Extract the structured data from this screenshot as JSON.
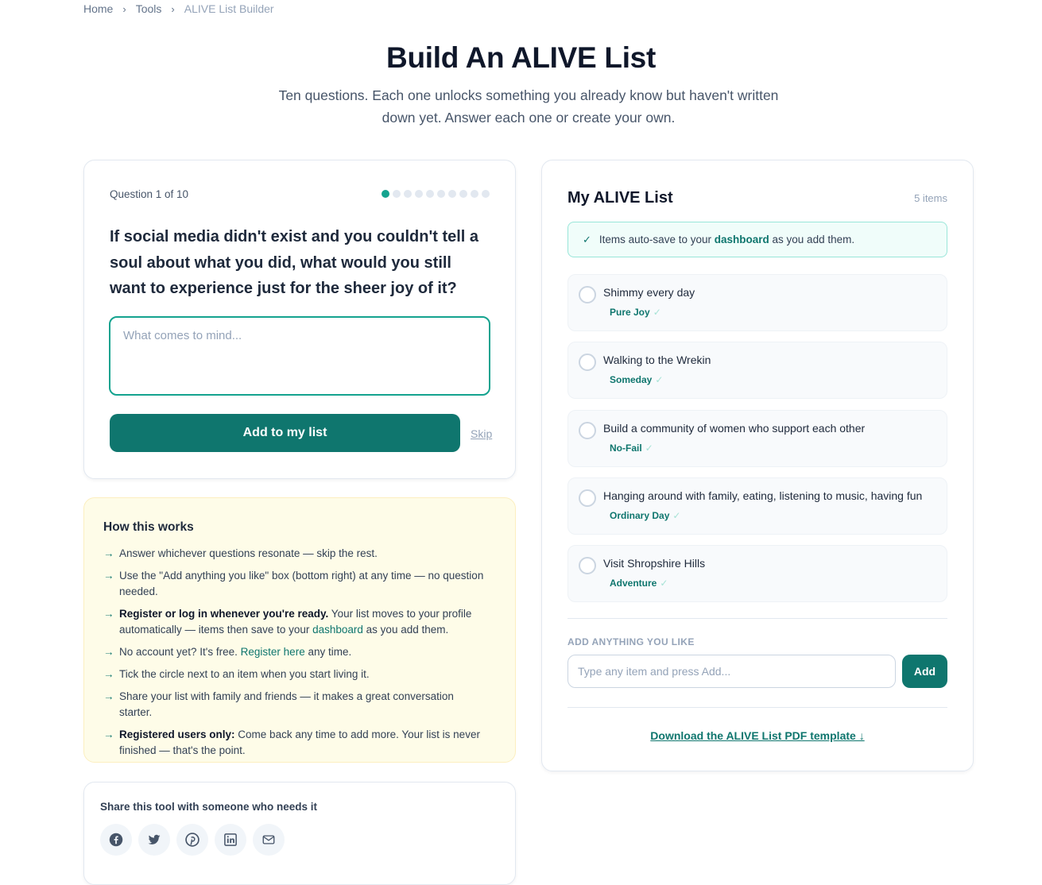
{
  "breadcrumb": {
    "home": "Home",
    "tools": "Tools",
    "current": "ALIVE List Builder",
    "separator": "›"
  },
  "header": {
    "title": "Build An ALIVE List",
    "subtitle": "Ten questions. Each one unlocks something you already know but haven't written down yet. Answer each one or create your own."
  },
  "question": {
    "label": "Question 1 of 10",
    "current": 1,
    "total": 10,
    "text": "If social media didn't exist and you couldn't tell a soul about what you did, what would you still want to experience just for the sheer joy of it?",
    "placeholder": "What comes to mind...",
    "add_label": "Add to my list",
    "skip_label": "Skip"
  },
  "how": {
    "title": "How this works",
    "arrow": "→",
    "items": {
      "i1": "Answer whichever questions resonate — skip the rest.",
      "i2": "Use the \"Add anything you like\" box (bottom right) at any time — no question needed.",
      "i3_bold": "Register or log in whenever you're ready.",
      "i3_pre": " Your list moves to your profile automatically — items then save to your ",
      "i3_link": "dashboard",
      "i3_post": " as you add them.",
      "i4_pre": "No account yet? It's free. ",
      "i4_link": "Register here",
      "i4_post": " any time.",
      "i5": "Tick the circle next to an item when you start living it.",
      "i6": "Share your list with family and friends — it makes a great conversation starter.",
      "i7_bold": "Registered users only:",
      "i7_rest": " Come back any time to add more. Your list is never finished — that's the point."
    }
  },
  "share": {
    "title": "Share this tool with someone who needs it",
    "icons": [
      "facebook-icon",
      "twitter-icon",
      "pinterest-icon",
      "linkedin-icon",
      "email-icon"
    ]
  },
  "list": {
    "title": "My ALIVE List",
    "count": "5 items",
    "autosave_check": "✓",
    "autosave_pre": "Items auto-save to your ",
    "autosave_link": "dashboard",
    "autosave_post": " as you add them.",
    "tick": "✓",
    "items": [
      {
        "text": "Shimmy every day",
        "tag": "Pure Joy"
      },
      {
        "text": "Walking to the Wrekin",
        "tag": "Someday"
      },
      {
        "text": "Build a community of women who support each other",
        "tag": "No-Fail"
      },
      {
        "text": "Hanging around with family, eating, listening to music, having fun",
        "tag": "Ordinary Day"
      },
      {
        "text": "Visit Shropshire Hills",
        "tag": "Adventure"
      }
    ],
    "anything_label": "ADD ANYTHING YOU LIKE",
    "anything_placeholder": "Type any item and press Add...",
    "anything_add": "Add",
    "download": "Download the ALIVE List PDF template ↓"
  },
  "colors": {
    "accent": "#0f766e",
    "accent_light": "#14a38f",
    "how_bg": "#fefce8"
  }
}
